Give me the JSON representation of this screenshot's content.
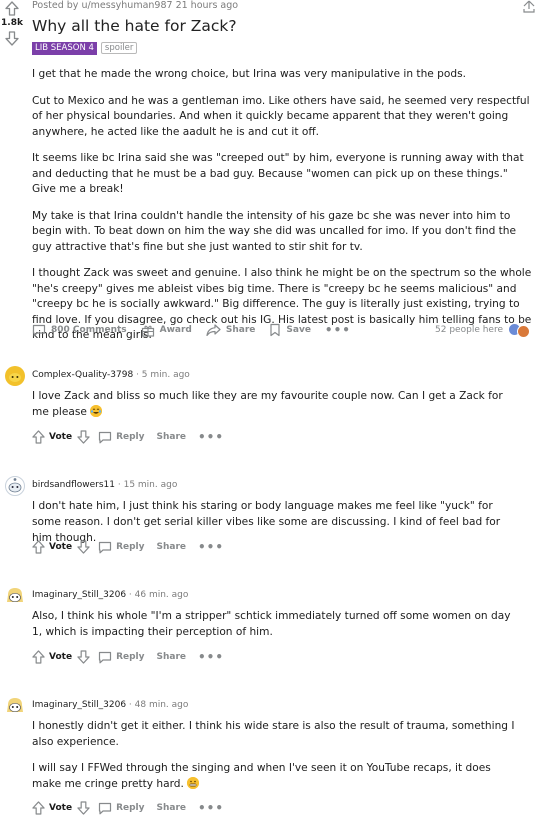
{
  "post": {
    "posted_by": "Posted by u/messyhuman987 21 hours ago",
    "vote_count": "1.8k",
    "title": "Why all the hate for Zack?",
    "flair": "LIB SEASON 4",
    "spoiler_tag": "spoiler",
    "paragraphs": [
      "I get that he made the wrong choice, but Irina was very manipulative in the pods.",
      "Cut to Mexico and he was a gentleman imo. Like others have said, he seemed very respectful of her physical boundaries. And when it quickly became apparent that they weren't going anywhere, he acted like the aadult he is and cut it off.",
      "It seems like bc Irina said she was \"creeped out\" by him, everyone is running away with that and deducting that he must be a bad guy. Because \"women can pick up on these things.\" Give me a break!",
      "My take is that Irina couldn't handle the intensity of his gaze bc she was never into him to begin with. To beat down on him the way she did was uncalled for imo. If you don't find the guy attractive that's fine but she just wanted to stir shit for tv.",
      "I thought Zack was sweet and genuine. I also think he might be on the spectrum so the whole \"he's creepy\" gives me ableist vibes big time. There is \"creepy bc he seems malicious\" and \"creepy bc he is socially awkward.\" Big difference. The guy is literally just existing, trying to find love. If you disagree, go check out his IG. His latest post is basically him telling fans to be kind to the mean girls."
    ],
    "actions": {
      "comments": "800 Comments",
      "award": "Award",
      "share": "Share",
      "save": "Save",
      "more": "•••",
      "people_here": "52 people here"
    }
  },
  "comments": [
    {
      "user": "Complex-Quality-3798",
      "time": " · 5 min. ago",
      "paragraphs": [
        "I love Zack and bliss so much like they are my favourite couple now. Can I get a Zack for me please "
      ],
      "emoji": "tears-of-joy-emoji",
      "avatar": "yellow-snoo-avatar",
      "vote": "Vote",
      "reply": "Reply",
      "share": "Share",
      "more": "•••"
    },
    {
      "user": "birdsandflowers11",
      "time": " · 15 min. ago",
      "paragraphs": [
        "I don't hate him, I just think his staring or body language makes me feel like \"yuck\" for some reason. I don't get serial killer vibes like some are discussing. I kind of feel bad for him though."
      ],
      "avatar": "blue-snoo-avatar",
      "vote": "Vote",
      "reply": "Reply",
      "share": "Share",
      "more": "•••"
    },
    {
      "user": "Imaginary_Still_3206",
      "time": " · 46 min. ago",
      "paragraphs": [
        "Also, I think his whole \"I'm a stripper\" schtick immediately turned off some women on day 1, which is impacting their perception of him."
      ],
      "avatar": "blonde-snoo-avatar",
      "vote": "Vote",
      "reply": "Reply",
      "share": "Share",
      "more": "•••"
    },
    {
      "user": "Imaginary_Still_3206",
      "time": " · 48 min. ago",
      "paragraphs": [
        "I honestly didn't get it either. I think his wide stare is also the result of trauma, something I also experience.",
        "I will say I FFWed through the singing and when I've seen it on YouTube recaps, it does make me cringe pretty hard. "
      ],
      "emoji": "grimacing-emoji",
      "avatar": "blonde-snoo-avatar",
      "vote": "Vote",
      "reply": "Reply",
      "share": "Share",
      "more": "•••"
    }
  ]
}
